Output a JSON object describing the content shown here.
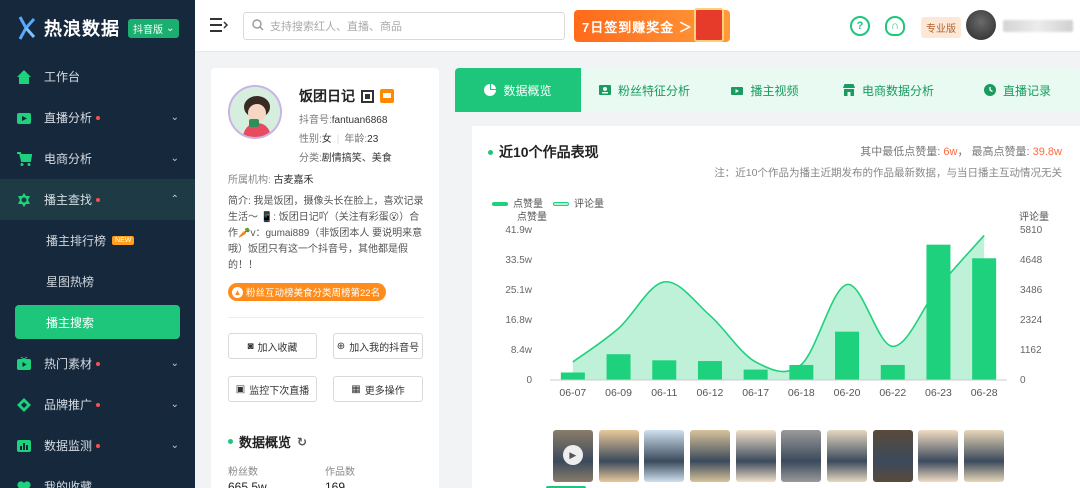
{
  "app": {
    "name": "热浪数据",
    "edition_badge": "抖音版"
  },
  "sidebar": {
    "items": [
      {
        "label": "工作台",
        "icon": "home-icon",
        "dot": false,
        "chevron": false
      },
      {
        "label": "直播分析",
        "icon": "live-video-icon",
        "dot": true,
        "chevron": true
      },
      {
        "label": "电商分析",
        "icon": "cart-icon",
        "dot": false,
        "chevron": true
      },
      {
        "label": "播主查找",
        "icon": "star-badge-icon",
        "dot": true,
        "chevron": true,
        "expanded": true
      },
      {
        "label": "热门素材",
        "icon": "tv-icon",
        "dot": true,
        "chevron": true
      },
      {
        "label": "品牌推广",
        "icon": "diamond-icon",
        "dot": true,
        "chevron": true
      },
      {
        "label": "数据监测",
        "icon": "bar-chart-icon",
        "dot": true,
        "chevron": true
      },
      {
        "label": "我的收藏",
        "icon": "heart-icon",
        "dot": false,
        "chevron": false
      }
    ],
    "subitems": [
      {
        "label": "播主排行榜",
        "badge": "NEW"
      },
      {
        "label": "星图热榜",
        "badge": ""
      },
      {
        "label": "播主搜索",
        "badge": ""
      }
    ]
  },
  "topbar": {
    "search_placeholder": "支持搜索红人、直播、商品",
    "banner_text": "7日签到赚奖金 ＞",
    "pro_label": "专业版"
  },
  "profile": {
    "name": "饭团日记",
    "douyin_id_label": "抖音号:",
    "douyin_id": "fantuan6868",
    "gender_label": "性别:",
    "gender": "女",
    "age_label": "年龄:",
    "age": "23",
    "category_label": "分类:",
    "category": "剧情搞笑、美食",
    "org_label": "所属机构:",
    "org": "古麦嘉禾",
    "bio": "简介: 我是饭团，摄像头长在脸上，喜欢记录生活～ 📱: 饭团日记吖（关注有彩蛋😮）合作🥕v：gumai889（非饭团本人 要说明来意哦）饭团只有这一个抖音号，其他都是假的！！",
    "rank_badge": "粉丝互动榜美食分类周榜第22名",
    "buttons": {
      "favorite": "加入收藏",
      "add_mine": "加入我的抖音号",
      "monitor": "监控下次直播",
      "more": "更多操作"
    },
    "overview_title": "数据概览",
    "fans_label": "粉丝数",
    "fans_value": "665.5w",
    "works_label": "作品数",
    "works_value": "169"
  },
  "tabs": [
    {
      "label": "数据概览",
      "icon": "pie-icon",
      "active": true
    },
    {
      "label": "粉丝特征分析",
      "icon": "id-card-icon",
      "active": false
    },
    {
      "label": "播主视频",
      "icon": "video-icon",
      "active": false
    },
    {
      "label": "电商数据分析",
      "icon": "shop-icon",
      "active": false
    },
    {
      "label": "直播记录",
      "icon": "clock-icon",
      "active": false
    }
  ],
  "panel": {
    "title": "近10个作品表现",
    "min_label": "其中最低点赞量:",
    "min_value": "6w",
    "max_label": "最高点赞量:",
    "max_value": "39.8w",
    "note": "注：近10个作品为播主近期发布的作品最新数据，与当日播主互动情况无关"
  },
  "chart_data": {
    "type": "bar",
    "categories": [
      "06-07",
      "06-09",
      "06-11",
      "06-12",
      "06-17",
      "06-18",
      "06-20",
      "06-22",
      "06-23",
      "06-28"
    ],
    "series": [
      {
        "name": "点赞量",
        "type": "bar",
        "axis": "left",
        "values": [
          2.1,
          7.2,
          5.5,
          5.3,
          2.9,
          4.2,
          13.5,
          4.2,
          37.8,
          34.0
        ]
      },
      {
        "name": "评论量",
        "type": "area",
        "axis": "right",
        "values": [
          700,
          2000,
          3800,
          2500,
          700,
          600,
          3700,
          1300,
          3600,
          5600
        ]
      }
    ],
    "ylabel": "点赞量",
    "ylabel_right": "评论量",
    "y_ticks": [
      "0",
      "8.4w",
      "16.8w",
      "25.1w",
      "33.5w",
      "41.9w"
    ],
    "y2_ticks": [
      "0",
      "1162",
      "2324",
      "3486",
      "4648",
      "5810"
    ],
    "ylim": [
      0,
      41.9
    ],
    "y2lim": [
      0,
      5810
    ],
    "colors": {
      "bar": "#1ed17c",
      "area": "#a8ecc9"
    }
  },
  "colors": {
    "accent": "#1ec67c",
    "sidebar_bg": "#16283c",
    "warn": "#ff6b3d"
  }
}
